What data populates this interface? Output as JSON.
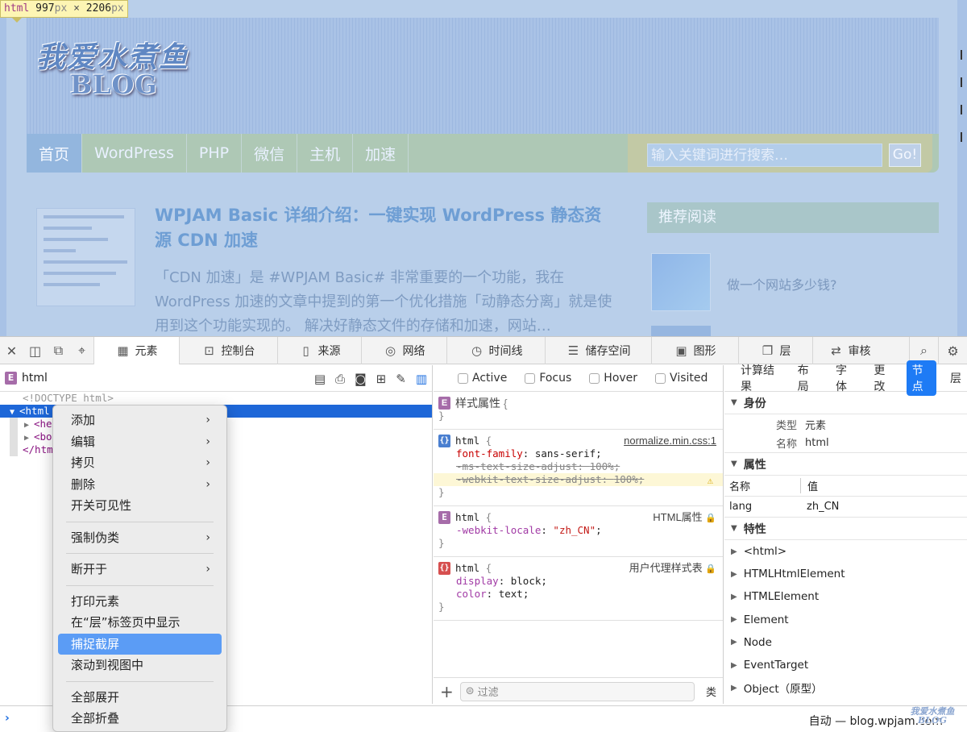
{
  "website": {
    "size_tip": {
      "tag": "html",
      "width": "997",
      "unit1": "px",
      "times": "×",
      "height": "2206",
      "unit2": "px"
    },
    "logo_line1": "我爱水煮鱼",
    "logo_line2": "BLOG",
    "nav": [
      "首页",
      "WordPress",
      "PHP",
      "微信",
      "主机",
      "加速"
    ],
    "search": {
      "placeholder": "输入关键词进行搜索…",
      "button": "Go!"
    },
    "post": {
      "title": "WPJAM Basic 详细介绍：一键实现 WordPress 静态资源 CDN 加速",
      "excerpt": "「CDN 加速」是 #WPJAM Basic# 非常重要的一个功能，我在 WordPress 加速的文章中提到的第一个优化措施「动静态分离」就是使用到这个功能实现的。 解决好静态文件的存储和加速，网站…"
    },
    "sidebar": {
      "title": "推荐阅读",
      "item": "做一个网站多少钱?"
    }
  },
  "devtools": {
    "tabs": [
      {
        "icon": "element-icon",
        "label": "元素"
      },
      {
        "icon": "console-icon",
        "label": "控制台"
      },
      {
        "icon": "source-icon",
        "label": "来源"
      },
      {
        "icon": "network-icon",
        "label": "网络"
      },
      {
        "icon": "timeline-icon",
        "label": "时间线"
      },
      {
        "icon": "storage-icon",
        "label": "储存空间"
      },
      {
        "icon": "graphics-icon",
        "label": "图形"
      },
      {
        "icon": "layers-icon",
        "label": "层"
      },
      {
        "icon": "audit-icon",
        "label": "审核"
      }
    ],
    "dom": {
      "breadcrumb": "html",
      "doctype": "<!DOCTYPE html>",
      "selected": "<html",
      "child1": "<he",
      "child2": "<bo",
      "close": "</htm"
    },
    "context_menu": {
      "items": [
        "添加",
        "编辑",
        "拷贝",
        "删除",
        "开关可见性",
        "强制伪类",
        "断开于",
        "打印元素",
        "在“层”标签页中显示",
        "捕捉截屏",
        "滚动到视图中",
        "全部展开",
        "全部折叠"
      ],
      "highlighted": "捕捉截屏"
    },
    "pseudo": [
      "Active",
      "Focus",
      "Hover",
      "Visited"
    ],
    "styles": {
      "style_attr": "样式属性",
      "rule1": {
        "selector": "html",
        "source": "normalize.min.css:1",
        "decl": [
          {
            "p": "font-family",
            "v": "sans-serif"
          },
          {
            "p": "-ms-text-size-adjust",
            "v": "100%"
          },
          {
            "p": "-webkit-text-size-adjust",
            "v": "100%"
          }
        ]
      },
      "rule2": {
        "selector": "html",
        "source": "HTML属性",
        "decl": [
          {
            "p": "-webkit-locale",
            "v": "\"zh_CN\""
          }
        ]
      },
      "rule3": {
        "selector": "html",
        "source": "用户代理样式表",
        "decl": [
          {
            "p": "display",
            "v": "block"
          },
          {
            "p": "color",
            "v": "text"
          }
        ]
      },
      "filter_placeholder": "过滤",
      "class_label": "类"
    },
    "node_tabs": [
      "计算结果",
      "布局",
      "字体",
      "更改",
      "节点",
      "层"
    ],
    "node_tab_active": "节点",
    "identity": {
      "title": "身份",
      "type_label": "类型",
      "type_value": "元素",
      "name_label": "名称",
      "name_value": "html"
    },
    "attributes": {
      "title": "属性",
      "col1": "名称",
      "col2": "值",
      "rows": [
        {
          "name": "lang",
          "value": "zh_CN"
        }
      ]
    },
    "properties": {
      "title": "特性",
      "items": [
        "<html>",
        "HTMLHtmlElement",
        "HTMLElement",
        "Element",
        "Node",
        "EventTarget",
        "Object（原型）"
      ]
    },
    "console": {
      "prompt": "›",
      "target": "自动 — blog.wpjam.com",
      "watermark": "我爱水煮鱼 BLOG"
    }
  }
}
